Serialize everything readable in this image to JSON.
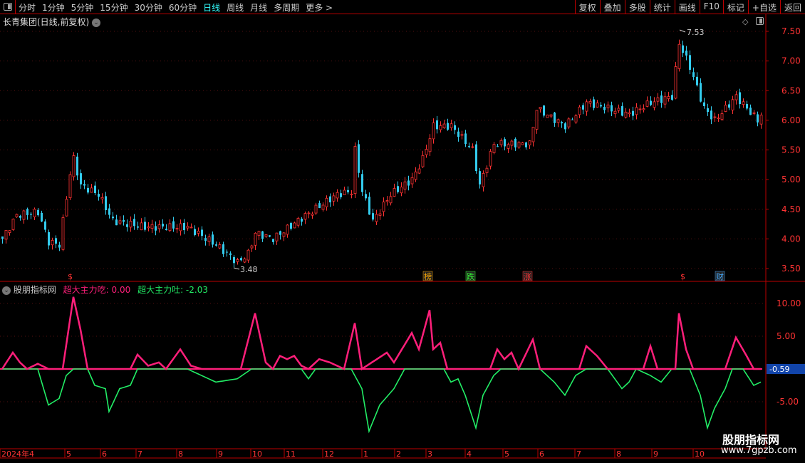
{
  "toolbar": {
    "periods": [
      "分时",
      "1分钟",
      "5分钟",
      "15分钟",
      "30分钟",
      "60分钟",
      "日线",
      "周线",
      "月线",
      "多周期",
      "更多 >"
    ],
    "active": "日线",
    "buttons": [
      "复权",
      "叠加",
      "多股",
      "统计",
      "画线",
      "F10",
      "标记",
      "+自选",
      "返回"
    ]
  },
  "chart_title": "长青集团(日线,前复权)",
  "price_axis": [
    "7.50",
    "7.00",
    "6.50",
    "6.00",
    "5.50",
    "5.00",
    "4.50",
    "4.00",
    "3.50"
  ],
  "max_label": "7.53",
  "min_label": "3.48",
  "markers": [
    {
      "bar": 20,
      "text": "$",
      "color": "#f33"
    },
    {
      "bar": 120,
      "text": "榜",
      "color": "#fa0"
    },
    {
      "bar": 132,
      "text": "跌",
      "color": "#3f3"
    },
    {
      "bar": 148,
      "text": "涨",
      "color": "#f33"
    },
    {
      "bar": 192,
      "text": "$",
      "color": "#f33"
    },
    {
      "bar": 202,
      "text": "财",
      "color": "#4af"
    }
  ],
  "indicator": {
    "name": "股朋指标网",
    "pink_label": "超大主力吃: 0.00",
    "green_label": "超大主力吐: -2.03",
    "current": "-0.59",
    "axis": [
      "10.00",
      "5.00",
      "-5.00"
    ]
  },
  "dates": [
    "2024年4",
    "5",
    "6",
    "7",
    "8",
    "9",
    "10",
    "11",
    "12",
    "1",
    "2",
    "3",
    "4",
    "5",
    "6",
    "7",
    "8",
    "9",
    "10"
  ],
  "watermark": {
    "name": "股朋指标网",
    "url": "www.7gpzb.com"
  },
  "chart_data": {
    "type": "candlestick",
    "colors": {
      "up": "#ff3333",
      "down": "#33ccee",
      "pink": "#ff1f7a",
      "green": "#22ee66"
    },
    "ylim": [
      3.35,
      7.65
    ],
    "close_path": [
      [
        0,
        4.0
      ],
      [
        4,
        4.4
      ],
      [
        10,
        4.45
      ],
      [
        13,
        3.95
      ],
      [
        16,
        3.9
      ],
      [
        19,
        5.1
      ],
      [
        20,
        5.35
      ],
      [
        22,
        4.9
      ],
      [
        27,
        4.75
      ],
      [
        31,
        4.3
      ],
      [
        40,
        4.2
      ],
      [
        52,
        4.2
      ],
      [
        60,
        3.9
      ],
      [
        66,
        3.6
      ],
      [
        69,
        3.75
      ],
      [
        71,
        4.1
      ],
      [
        76,
        4.0
      ],
      [
        84,
        4.35
      ],
      [
        94,
        4.75
      ],
      [
        98,
        4.8
      ],
      [
        99,
        5.5
      ],
      [
        101,
        4.8
      ],
      [
        104,
        4.3
      ],
      [
        109,
        4.75
      ],
      [
        115,
        5.0
      ],
      [
        118,
        5.35
      ],
      [
        121,
        5.9
      ],
      [
        126,
        5.9
      ],
      [
        132,
        5.5
      ],
      [
        134,
        4.9
      ],
      [
        138,
        5.6
      ],
      [
        148,
        5.6
      ],
      [
        150,
        6.2
      ],
      [
        158,
        5.9
      ],
      [
        164,
        6.3
      ],
      [
        170,
        6.2
      ],
      [
        176,
        6.1
      ],
      [
        182,
        6.3
      ],
      [
        188,
        6.4
      ],
      [
        190,
        7.3
      ],
      [
        193,
        6.9
      ],
      [
        197,
        6.2
      ],
      [
        200,
        6.0
      ],
      [
        206,
        6.4
      ],
      [
        212,
        6.0
      ],
      [
        213,
        6.1
      ]
    ],
    "pink": [
      [
        0,
        0
      ],
      [
        3,
        2.5
      ],
      [
        5,
        1
      ],
      [
        7,
        0
      ],
      [
        10,
        0.8
      ],
      [
        13,
        0
      ],
      [
        17,
        0
      ],
      [
        20,
        11
      ],
      [
        22,
        6
      ],
      [
        24,
        0
      ],
      [
        36,
        0
      ],
      [
        38,
        2.2
      ],
      [
        41,
        0.5
      ],
      [
        44,
        1
      ],
      [
        46,
        0
      ],
      [
        50,
        3
      ],
      [
        53,
        0.5
      ],
      [
        56,
        0
      ],
      [
        67,
        0
      ],
      [
        71,
        8.5
      ],
      [
        74,
        1
      ],
      [
        76,
        0
      ],
      [
        78,
        2
      ],
      [
        80,
        1.5
      ],
      [
        82,
        2
      ],
      [
        84,
        0.5
      ],
      [
        86,
        0
      ],
      [
        89,
        1.5
      ],
      [
        92,
        1
      ],
      [
        96,
        0
      ],
      [
        99,
        7
      ],
      [
        101,
        0
      ],
      [
        108,
        2.5
      ],
      [
        110,
        1
      ],
      [
        115,
        5.5
      ],
      [
        117,
        3
      ],
      [
        120,
        9
      ],
      [
        121,
        3
      ],
      [
        123,
        4
      ],
      [
        125,
        0
      ],
      [
        137,
        0
      ],
      [
        139,
        3
      ],
      [
        141,
        1.5
      ],
      [
        143,
        2.5
      ],
      [
        145,
        0
      ],
      [
        149,
        4.5
      ],
      [
        151,
        0
      ],
      [
        162,
        0
      ],
      [
        164,
        3.5
      ],
      [
        167,
        2
      ],
      [
        170,
        0
      ],
      [
        180,
        0
      ],
      [
        182,
        3.5
      ],
      [
        184,
        0
      ],
      [
        189,
        0
      ],
      [
        190,
        8.5
      ],
      [
        192,
        3
      ],
      [
        194,
        0
      ],
      [
        203,
        0
      ],
      [
        206,
        4.8
      ],
      [
        209,
        2
      ],
      [
        211,
        0
      ],
      [
        213,
        0
      ]
    ],
    "green": [
      [
        0,
        0
      ],
      [
        10,
        0
      ],
      [
        13,
        -5.5
      ],
      [
        16,
        -4.5
      ],
      [
        18,
        -1
      ],
      [
        20,
        0
      ],
      [
        24,
        0
      ],
      [
        26,
        -2.5
      ],
      [
        29,
        -3
      ],
      [
        30,
        -6.5
      ],
      [
        33,
        -3
      ],
      [
        36,
        -2.5
      ],
      [
        38,
        0
      ],
      [
        46,
        0
      ],
      [
        52,
        0
      ],
      [
        60,
        -2
      ],
      [
        66,
        -1.5
      ],
      [
        70,
        0
      ],
      [
        84,
        0
      ],
      [
        86,
        -1.5
      ],
      [
        88,
        0
      ],
      [
        98,
        0
      ],
      [
        101,
        -3
      ],
      [
        103,
        -9.5
      ],
      [
        106,
        -5.5
      ],
      [
        110,
        -3
      ],
      [
        113,
        0
      ],
      [
        124,
        0
      ],
      [
        126,
        -2
      ],
      [
        128,
        -1.5
      ],
      [
        130,
        -4
      ],
      [
        133,
        -9
      ],
      [
        135,
        -4
      ],
      [
        138,
        -1
      ],
      [
        140,
        0
      ],
      [
        146,
        0
      ],
      [
        151,
        0
      ],
      [
        153,
        -1
      ],
      [
        155,
        -2
      ],
      [
        158,
        -4
      ],
      [
        161,
        -1
      ],
      [
        164,
        0
      ],
      [
        170,
        0
      ],
      [
        174,
        -3
      ],
      [
        176,
        -2
      ],
      [
        178,
        0
      ],
      [
        182,
        -1
      ],
      [
        185,
        -2
      ],
      [
        188,
        0
      ],
      [
        193,
        0
      ],
      [
        196,
        -4
      ],
      [
        198,
        -9
      ],
      [
        200,
        -6
      ],
      [
        203,
        -3
      ],
      [
        205,
        0
      ],
      [
        208,
        0
      ],
      [
        211,
        -2.5
      ],
      [
        213,
        -2
      ]
    ],
    "ind_ylim": [
      -9.8,
      13
    ]
  }
}
